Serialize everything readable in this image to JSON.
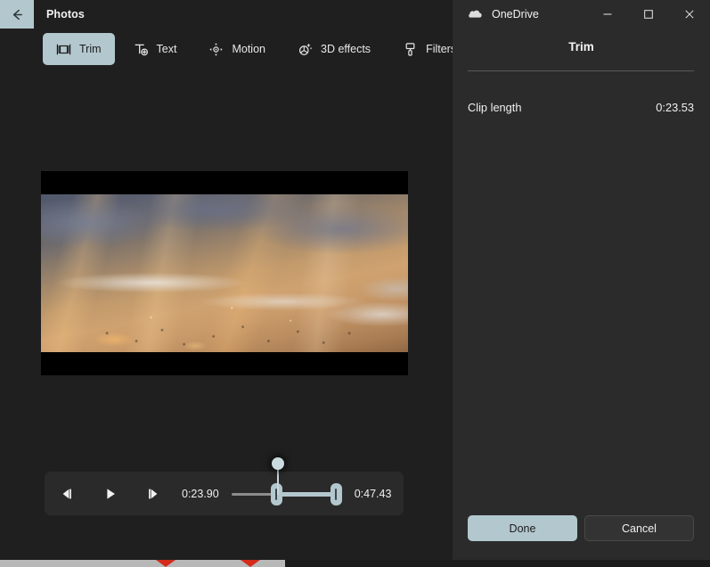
{
  "photos": {
    "title": "Photos",
    "back_icon": "back-arrow-icon",
    "toolbar": [
      {
        "label": "Trim",
        "icon": "trim-icon",
        "active": true
      },
      {
        "label": "Text",
        "icon": "text-add-icon",
        "active": false
      },
      {
        "label": "Motion",
        "icon": "motion-icon",
        "active": false
      },
      {
        "label": "3D effects",
        "icon": "three-d-effects-icon",
        "active": false
      },
      {
        "label": "Filters",
        "icon": "filters-brush-icon",
        "active": false
      }
    ],
    "transport": {
      "previous_frame_icon": "previous-frame-icon",
      "play_icon": "play-icon",
      "next_frame_icon": "next-frame-icon",
      "current_time": "0:23.90",
      "total_time": "0:47.43",
      "trim_start_handle": "trim-start-handle",
      "trim_end_handle": "trim-end-handle",
      "playhead": "playhead-scrubber"
    },
    "preview": {
      "media": "beach-sunset-waves-video-frame",
      "letterboxed": true
    }
  },
  "onedrive": {
    "window_title": "OneDrive",
    "cloud_icon": "onedrive-cloud-icon",
    "caption": {
      "minimize": "minimize-icon",
      "maximize": "maximize-icon",
      "close": "close-icon"
    },
    "panel": {
      "title": "Trim",
      "clip_length_label": "Clip length",
      "clip_length_value": "0:23.53"
    },
    "actions": {
      "done_label": "Done",
      "cancel_label": "Cancel"
    }
  },
  "colors": {
    "accent": "#b3c8ce",
    "photos_bg": "#1f1f1f",
    "onedrive_bg": "#2b2b2b",
    "transport_bg": "#2a2a2a",
    "strip": "#b8b8b8",
    "chevron": "#d42b1c"
  }
}
